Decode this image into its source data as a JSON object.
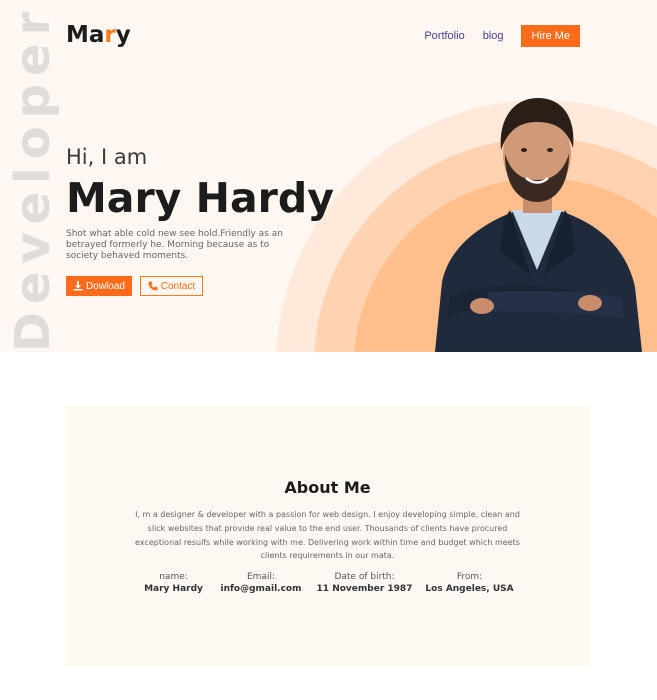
{
  "hero": {
    "vertical_word": "Developer",
    "logo": {
      "part1": "Ma",
      "accent": "r",
      "part2": "y"
    },
    "nav": {
      "portfolio": "Portfolio",
      "blog": "blog",
      "hire": "Hire Me"
    },
    "greeting": "Hi, I am",
    "name": "Mary Hardy",
    "description": "Shot what able cold new see hold.Friendly as an betrayed formerly he. Morning because as to society behaved moments.",
    "download_label": "Dowload",
    "contact_label": "Contact"
  },
  "about": {
    "title": "About Me",
    "text": "I, m a designer & developer with a passion for web design. I enjoy developing simple, clean and slick websites that provide real value to the end user. Thousands of clients have procured exceptional resulfs while working with me. Delivering work within time and budget which meets clients requirements in our mata.",
    "info": [
      {
        "label": "name:",
        "value": "Mary Hardy"
      },
      {
        "label": "Email:",
        "value": "info@gmail.com"
      },
      {
        "label": "Date of birth:",
        "value": "11 November 1987"
      },
      {
        "label": "From:",
        "value": "Los Angeles, USA"
      }
    ]
  },
  "colors": {
    "accent": "#ff6b1a",
    "hero_bg": "#fff7f1",
    "about_bg": "#fff8f3",
    "nav_text": "#4b3b8f"
  },
  "icons": {
    "download": "download-icon",
    "contact": "phone-icon"
  }
}
